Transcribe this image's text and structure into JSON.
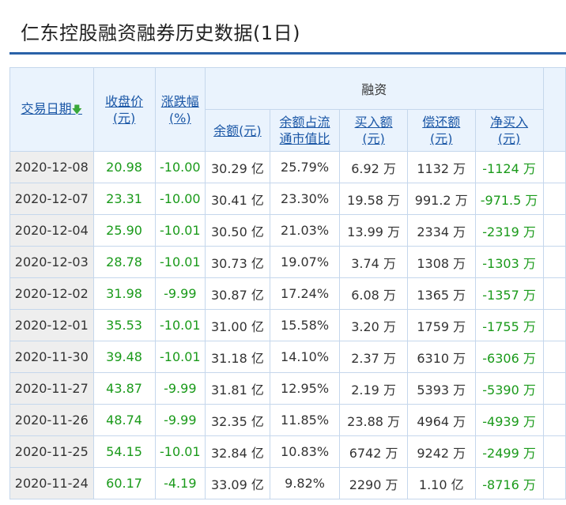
{
  "page": {
    "title": "仁东控股融资融券历史数据(1日)"
  },
  "header": {
    "date": "交易日期",
    "close": [
      "收盘价",
      "(元)"
    ],
    "change": [
      "涨跌幅",
      "(%)"
    ],
    "group": "融资",
    "balance": "余额(元)",
    "ratio": [
      "余额占流",
      "通市值比"
    ],
    "buy": [
      "买入额",
      "(元)"
    ],
    "repay": [
      "偿还额",
      "(元)"
    ],
    "net": [
      "净买入",
      "(元)"
    ],
    "cut": "余"
  },
  "rows": [
    {
      "date": "2020-12-08",
      "close": "20.98",
      "change": "-10.00",
      "balance": "30.29 亿",
      "ratio": "25.79%",
      "buy": "6.92 万",
      "repay": "1132 万",
      "net": "-1124 万"
    },
    {
      "date": "2020-12-07",
      "close": "23.31",
      "change": "-10.00",
      "balance": "30.41 亿",
      "ratio": "23.30%",
      "buy": "19.58 万",
      "repay": "991.2 万",
      "net": "-971.5 万"
    },
    {
      "date": "2020-12-04",
      "close": "25.90",
      "change": "-10.01",
      "balance": "30.50 亿",
      "ratio": "21.03%",
      "buy": "13.99 万",
      "repay": "2334 万",
      "net": "-2319 万"
    },
    {
      "date": "2020-12-03",
      "close": "28.78",
      "change": "-10.01",
      "balance": "30.73 亿",
      "ratio": "19.07%",
      "buy": "3.74 万",
      "repay": "1308 万",
      "net": "-1303 万"
    },
    {
      "date": "2020-12-02",
      "close": "31.98",
      "change": "-9.99",
      "balance": "30.87 亿",
      "ratio": "17.24%",
      "buy": "6.08 万",
      "repay": "1365 万",
      "net": "-1357 万"
    },
    {
      "date": "2020-12-01",
      "close": "35.53",
      "change": "-10.01",
      "balance": "31.00 亿",
      "ratio": "15.58%",
      "buy": "3.20 万",
      "repay": "1759 万",
      "net": "-1755 万"
    },
    {
      "date": "2020-11-30",
      "close": "39.48",
      "change": "-10.01",
      "balance": "31.18 亿",
      "ratio": "14.10%",
      "buy": "2.37 万",
      "repay": "6310 万",
      "net": "-6306 万"
    },
    {
      "date": "2020-11-27",
      "close": "43.87",
      "change": "-9.99",
      "balance": "31.81 亿",
      "ratio": "12.95%",
      "buy": "2.19 万",
      "repay": "5393 万",
      "net": "-5390 万"
    },
    {
      "date": "2020-11-26",
      "close": "48.74",
      "change": "-9.99",
      "balance": "32.35 亿",
      "ratio": "11.85%",
      "buy": "23.88 万",
      "repay": "4964 万",
      "net": "-4939 万"
    },
    {
      "date": "2020-11-25",
      "close": "54.15",
      "change": "-10.01",
      "balance": "32.84 亿",
      "ratio": "10.83%",
      "buy": "6742 万",
      "repay": "9242 万",
      "net": "-2499 万"
    },
    {
      "date": "2020-11-24",
      "close": "60.17",
      "change": "-4.19",
      "balance": "33.09 亿",
      "ratio": "9.82%",
      "buy": "2290 万",
      "repay": "1.10 亿",
      "net": "-8716 万"
    }
  ],
  "colors": {
    "accent": "#2a62a8",
    "link": "#1b57a6",
    "down": "#1a9a1a"
  }
}
